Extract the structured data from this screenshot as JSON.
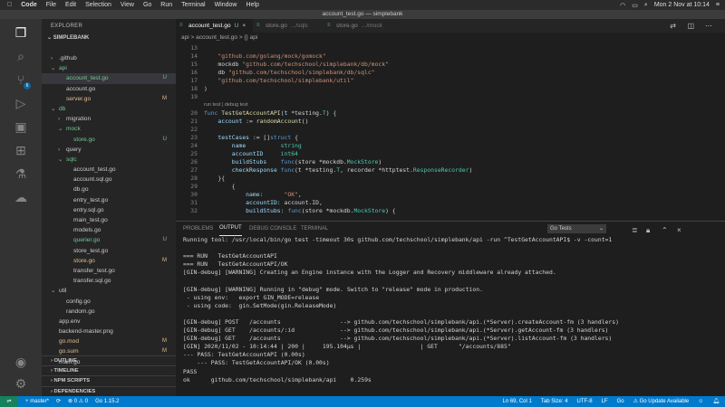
{
  "menubar": {
    "apple": "",
    "app": "Code",
    "items": [
      "File",
      "Edit",
      "Selection",
      "View",
      "Go",
      "Run",
      "Terminal",
      "Window",
      "Help"
    ],
    "datetime": "Mon 2 Nov at 10:14"
  },
  "window_title": "account_test.go — simplebank",
  "activity": {
    "scm_badge": "6"
  },
  "explorer": {
    "title": "EXPLORER",
    "project": "SIMPLEBANK",
    "items": [
      {
        "label": ".github",
        "indent": 1,
        "type": "folder",
        "open": false,
        "status": "",
        "color": ""
      },
      {
        "label": "api",
        "indent": 1,
        "type": "folder",
        "open": true,
        "status": "",
        "color": "green"
      },
      {
        "label": "account_test.go",
        "indent": 2,
        "type": "file",
        "status": "U",
        "color": "green",
        "selected": true
      },
      {
        "label": "account.go",
        "indent": 2,
        "type": "file",
        "status": "",
        "color": ""
      },
      {
        "label": "server.go",
        "indent": 2,
        "type": "file",
        "status": "M",
        "color": "yellow"
      },
      {
        "label": "db",
        "indent": 1,
        "type": "folder",
        "open": true,
        "status": "",
        "color": "green"
      },
      {
        "label": "migration",
        "indent": 2,
        "type": "folder",
        "open": false,
        "status": "",
        "color": ""
      },
      {
        "label": "mock",
        "indent": 2,
        "type": "folder",
        "open": true,
        "status": "",
        "color": "green"
      },
      {
        "label": "store.go",
        "indent": 3,
        "type": "file",
        "status": "U",
        "color": "green"
      },
      {
        "label": "query",
        "indent": 2,
        "type": "folder",
        "open": false,
        "status": "",
        "color": ""
      },
      {
        "label": "sqlc",
        "indent": 2,
        "type": "folder",
        "open": true,
        "status": "",
        "color": "green"
      },
      {
        "label": "account_test.go",
        "indent": 3,
        "type": "file",
        "status": "",
        "color": ""
      },
      {
        "label": "account.sql.go",
        "indent": 3,
        "type": "file",
        "status": "",
        "color": ""
      },
      {
        "label": "db.go",
        "indent": 3,
        "type": "file",
        "status": "",
        "color": ""
      },
      {
        "label": "entry_test.go",
        "indent": 3,
        "type": "file",
        "status": "",
        "color": ""
      },
      {
        "label": "entry.sql.go",
        "indent": 3,
        "type": "file",
        "status": "",
        "color": ""
      },
      {
        "label": "main_test.go",
        "indent": 3,
        "type": "file",
        "status": "",
        "color": ""
      },
      {
        "label": "models.go",
        "indent": 3,
        "type": "file",
        "status": "",
        "color": ""
      },
      {
        "label": "querier.go",
        "indent": 3,
        "type": "file",
        "status": "U",
        "color": "green"
      },
      {
        "label": "store_test.go",
        "indent": 3,
        "type": "file",
        "status": "",
        "color": ""
      },
      {
        "label": "store.go",
        "indent": 3,
        "type": "file",
        "status": "M",
        "color": "yellow"
      },
      {
        "label": "transfer_test.go",
        "indent": 3,
        "type": "file",
        "status": "",
        "color": ""
      },
      {
        "label": "transfer.sql.go",
        "indent": 3,
        "type": "file",
        "status": "",
        "color": ""
      },
      {
        "label": "util",
        "indent": 1,
        "type": "folder",
        "open": true,
        "status": "",
        "color": ""
      },
      {
        "label": "config.go",
        "indent": 2,
        "type": "file",
        "status": "",
        "color": ""
      },
      {
        "label": "random.go",
        "indent": 2,
        "type": "file",
        "status": "",
        "color": ""
      },
      {
        "label": "app.env",
        "indent": 1,
        "type": "file",
        "status": "",
        "color": ""
      },
      {
        "label": "backend-master.png",
        "indent": 1,
        "type": "file",
        "status": "",
        "color": ""
      },
      {
        "label": "go.mod",
        "indent": 1,
        "type": "file",
        "status": "M",
        "color": "yellow"
      },
      {
        "label": "go.sum",
        "indent": 1,
        "type": "file",
        "status": "M",
        "color": "yellow"
      },
      {
        "label": "main.go",
        "indent": 1,
        "type": "file",
        "status": "",
        "color": ""
      }
    ],
    "panes": [
      "OUTLINE",
      "TIMELINE",
      "NPM SCRIPTS",
      "DEPENDENCIES"
    ]
  },
  "tabs": [
    {
      "label": "account_test.go",
      "sub": "U",
      "active": true
    },
    {
      "label": "store.go",
      "sub": ".../sqlc",
      "active": false
    },
    {
      "label": "store.go",
      "sub": ".../mock",
      "active": false
    }
  ],
  "breadcrumb": [
    "api",
    ">",
    "account_test.go",
    ">",
    "{} api"
  ],
  "codelens": "run test | debug test",
  "code_lines": [
    {
      "n": "13",
      "html": ""
    },
    {
      "n": "14",
      "parts": [
        [
          "s",
          "\t\"github.com/golang/mock/gomock\""
        ]
      ]
    },
    {
      "n": "15",
      "parts": [
        [
          "w",
          "\tmockdb "
        ],
        [
          "s",
          "\"github.com/techschool/simplebank/db/mock\""
        ]
      ]
    },
    {
      "n": "16",
      "parts": [
        [
          "w",
          "\tdb "
        ],
        [
          "s",
          "\"github.com/techschool/simplebank/db/sqlc\""
        ]
      ]
    },
    {
      "n": "17",
      "parts": [
        [
          "s",
          "\t\"github.com/techschool/simplebank/util\""
        ]
      ]
    },
    {
      "n": "18",
      "parts": [
        [
          "w",
          ")"
        ]
      ]
    },
    {
      "n": "19",
      "parts": []
    },
    {
      "n": "20",
      "parts": [
        [
          "k",
          "func "
        ],
        [
          "f",
          "TestGetAccountAPI"
        ],
        [
          "w",
          "("
        ],
        [
          "v",
          "t "
        ],
        [
          "w",
          "*testing."
        ],
        [
          "ty",
          "T"
        ],
        [
          "w",
          ") {"
        ]
      ]
    },
    {
      "n": "21",
      "parts": [
        [
          "v",
          "\taccount "
        ],
        [
          "w",
          ":= "
        ],
        [
          "f",
          "randomAccount"
        ],
        [
          "w",
          "()"
        ]
      ]
    },
    {
      "n": "22",
      "parts": []
    },
    {
      "n": "23",
      "parts": [
        [
          "v",
          "\ttestCases "
        ],
        [
          "w",
          ":= []"
        ],
        [
          "k",
          "struct "
        ],
        [
          "w",
          "{"
        ]
      ]
    },
    {
      "n": "24",
      "parts": [
        [
          "v",
          "\t\tname          "
        ],
        [
          "ty",
          "string"
        ]
      ]
    },
    {
      "n": "25",
      "parts": [
        [
          "v",
          "\t\taccountID     "
        ],
        [
          "ty",
          "int64"
        ]
      ]
    },
    {
      "n": "26",
      "parts": [
        [
          "v",
          "\t\tbuildStubs    "
        ],
        [
          "k",
          "func"
        ],
        [
          "w",
          "(store *mockdb."
        ],
        [
          "ty",
          "MockStore"
        ],
        [
          "w",
          ")"
        ]
      ]
    },
    {
      "n": "27",
      "parts": [
        [
          "v",
          "\t\tcheckResponse "
        ],
        [
          "k",
          "func"
        ],
        [
          "w",
          "(t *testing."
        ],
        [
          "ty",
          "T"
        ],
        [
          "w",
          ", recorder *httptest."
        ],
        [
          "ty",
          "ResponseRecorder"
        ],
        [
          "w",
          ")"
        ]
      ]
    },
    {
      "n": "28",
      "parts": [
        [
          "w",
          "\t}{"
        ]
      ]
    },
    {
      "n": "29",
      "parts": [
        [
          "w",
          "\t\t{"
        ]
      ]
    },
    {
      "n": "30",
      "parts": [
        [
          "v",
          "\t\t\tname:      "
        ],
        [
          "s",
          "\"OK\""
        ],
        [
          "w",
          ","
        ]
      ]
    },
    {
      "n": "31",
      "parts": [
        [
          "v",
          "\t\t\taccountID: "
        ],
        [
          "w",
          "account.ID,"
        ]
      ]
    },
    {
      "n": "32",
      "parts": [
        [
          "v",
          "\t\t\tbuildStubs: "
        ],
        [
          "k",
          "func"
        ],
        [
          "w",
          "(store *mockdb."
        ],
        [
          "ty",
          "MockStore"
        ],
        [
          "w",
          ") {"
        ]
      ]
    }
  ],
  "panel": {
    "tabs": [
      "PROBLEMS",
      "OUTPUT",
      "DEBUG CONSOLE",
      "TERMINAL"
    ],
    "active_tab": "OUTPUT",
    "channel": "Go Tests",
    "lines": [
      "Running tool: /usr/local/bin/go test -timeout 30s github.com/techschool/simplebank/api -run ^TestGetAccountAPI$ -v -count=1",
      "",
      "=== RUN   TestGetAccountAPI",
      "=== RUN   TestGetAccountAPI/OK",
      "[GIN-debug] [WARNING] Creating an Engine instance with the Logger and Recovery middleware already attached.",
      "",
      "[GIN-debug] [WARNING] Running in \"debug\" mode. Switch to \"release\" mode in production.",
      " - using env:   export GIN_MODE=release",
      " - using code:  gin.SetMode(gin.ReleaseMode)",
      "",
      "[GIN-debug] POST   /accounts                 --> github.com/techschool/simplebank/api.(*Server).createAccount-fm (3 handlers)",
      "[GIN-debug] GET    /accounts/:id             --> github.com/techschool/simplebank/api.(*Server).getAccount-fm (3 handlers)",
      "[GIN-debug] GET    /accounts                 --> github.com/techschool/simplebank/api.(*Server).listAccount-fm (3 handlers)",
      "[GIN] 2020/11/02 - 10:14:44 | 200 |     195.104µs |                 | GET      \"/accounts/885\"",
      "--- PASS: TestGetAccountAPI (0.00s)",
      "    --- PASS: TestGetAccountAPI/OK (0.00s)",
      "PASS",
      "ok      github.com/techschool/simplebank/api    0.259s"
    ]
  },
  "status": {
    "branch": "master*",
    "errors": "0",
    "warnings": "0",
    "go_version": "Go 1.15.2",
    "position": "Ln 69, Col 1",
    "tab_size": "Tab Size: 4",
    "encoding": "UTF-8",
    "eol": "LF",
    "language": "Go",
    "update": "Go Update Available"
  }
}
